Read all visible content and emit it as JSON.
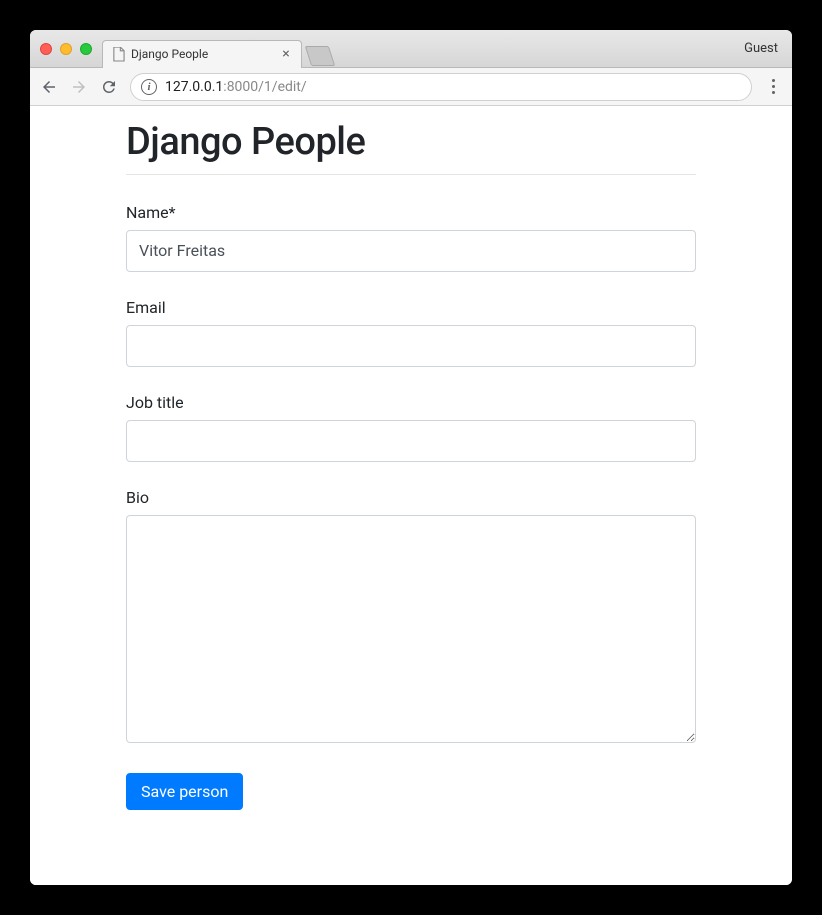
{
  "browser": {
    "tab_title": "Django People",
    "guest_label": "Guest",
    "url_host": "127.0.0.1",
    "url_port_path": ":8000/1/edit/"
  },
  "page": {
    "heading": "Django People"
  },
  "form": {
    "name": {
      "label": "Name*",
      "value": "Vitor Freitas"
    },
    "email": {
      "label": "Email",
      "value": ""
    },
    "job_title": {
      "label": "Job title",
      "value": ""
    },
    "bio": {
      "label": "Bio",
      "value": ""
    },
    "submit_label": "Save person"
  }
}
